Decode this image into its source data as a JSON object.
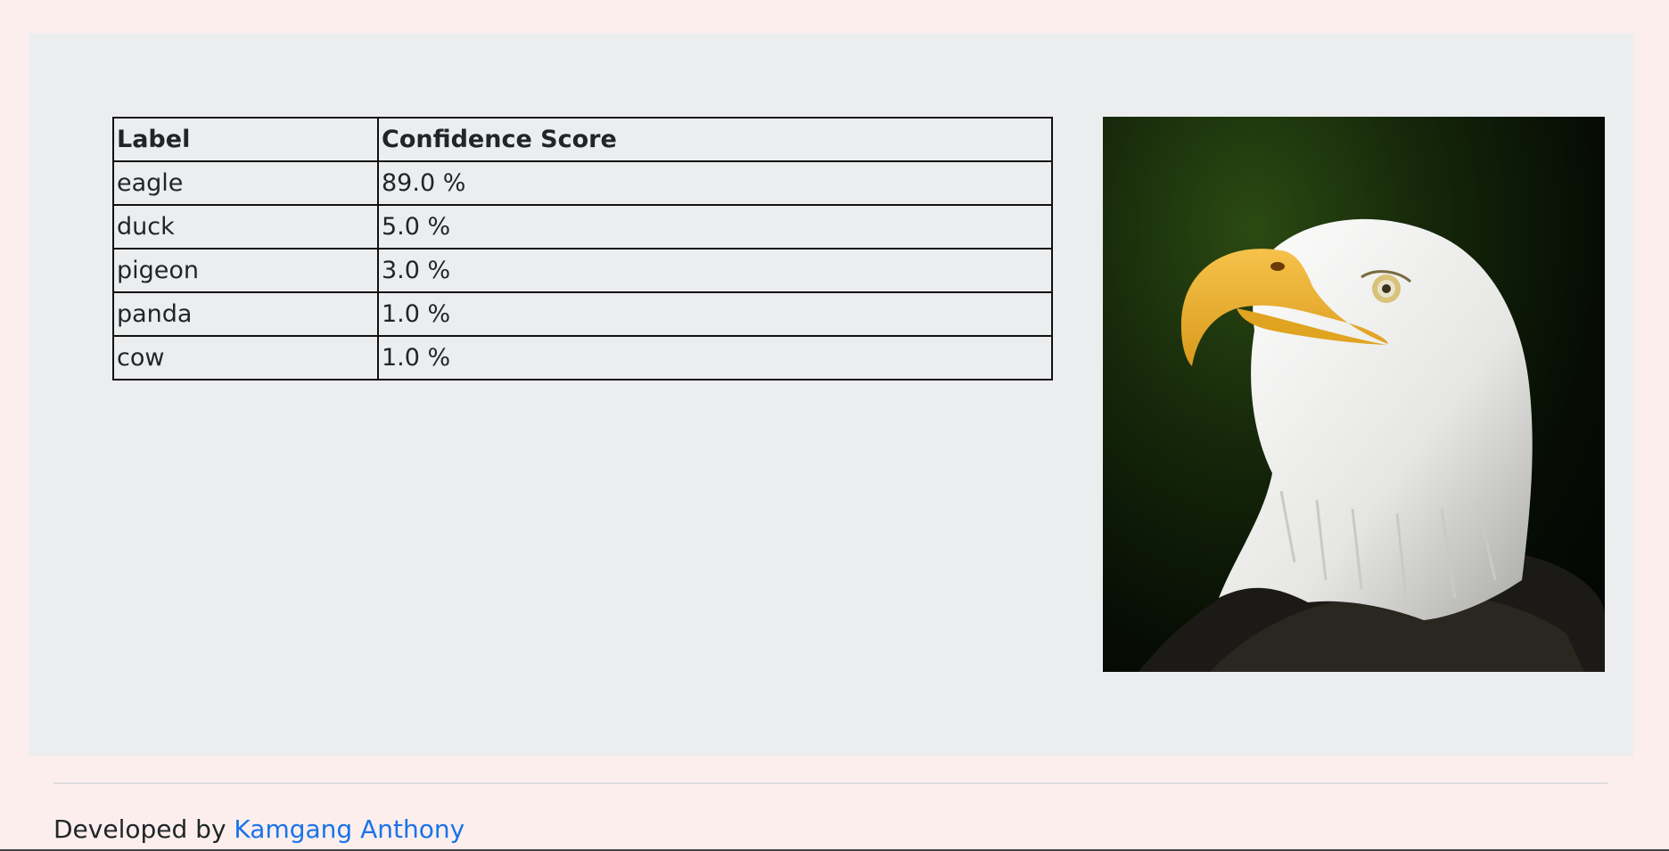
{
  "table": {
    "headers": [
      "Label",
      "Confidence Score"
    ],
    "rows": [
      {
        "label": "eagle",
        "score": "89.0 %"
      },
      {
        "label": "duck",
        "score": "5.0 %"
      },
      {
        "label": "pigeon",
        "score": "3.0 %"
      },
      {
        "label": "panda",
        "score": "1.0 %"
      },
      {
        "label": "cow",
        "score": "1.0 %"
      }
    ]
  },
  "image": {
    "subject": "bald eagle head in profile"
  },
  "footer": {
    "prefix": "Developed by",
    "author_link": "Kamgang Anthony"
  },
  "colors": {
    "page_bg": "#fbeeed",
    "panel_bg": "#ecedef",
    "link": "#1a73e8"
  }
}
